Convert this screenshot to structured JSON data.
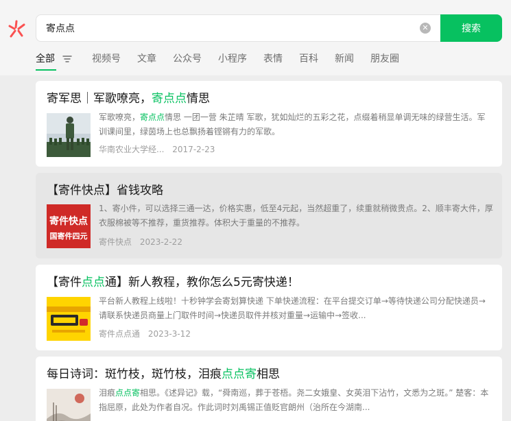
{
  "search": {
    "query": "寄点点",
    "button_label": "搜索",
    "clear_symbol": "✕"
  },
  "tabs": [
    {
      "label": "全部"
    },
    {
      "label": "视频号"
    },
    {
      "label": "文章"
    },
    {
      "label": "公众号"
    },
    {
      "label": "小程序"
    },
    {
      "label": "表情"
    },
    {
      "label": "百科"
    },
    {
      "label": "新闻"
    },
    {
      "label": "朋友圈"
    }
  ],
  "results": [
    {
      "title": [
        {
          "t": "寄军思｜军歌嘹亮，"
        },
        {
          "t": "寄点点",
          "hl": true
        },
        {
          "t": "情思"
        }
      ],
      "snippet": [
        {
          "t": "军歌嘹亮，"
        },
        {
          "t": "寄点点",
          "hl": true
        },
        {
          "t": "情思 一团一营 朱芷晴 军歌，犹如灿烂的五彩之花，点缀着稍显单调无味的绿营生活。军训课间里，绿茵场上也总飘扬着铿锵有力的军歌。"
        }
      ],
      "source": "华南农业大学经...",
      "date": "2017-2-23",
      "thumb_icon": "soldiers-photo-icon"
    },
    {
      "title": [
        {
          "t": "【寄件快点】省钱攻略"
        }
      ],
      "snippet": [
        {
          "t": "1、寄小件，可以选择三通一达，价格实惠，低至4元起，当然超重了，续重就稍微贵点。2、顺丰寄大件，厚衣服棉被等不推荐，重货推荐。体积大于重量的不推荐。"
        }
      ],
      "source": "寄件快点",
      "date": "2023-2-22",
      "thumb_icon": "promo-banner-icon",
      "thumb_text": [
        "寄件快点",
        "国寄件四元"
      ]
    },
    {
      "title": [
        {
          "t": "【寄件"
        },
        {
          "t": "点点",
          "hl": true
        },
        {
          "t": "通】新人教程，教你怎么5元寄快递！"
        }
      ],
      "snippet": [
        {
          "t": "平台新人教程上线啦！十秒钟学会寄划算快递 下单快递流程：在平台提交订单→等待快递公司分配快递员→请联系快递员商量上门取件时间→快递员取件并核对重量→运输中→签收..."
        }
      ],
      "source": "寄件点点通",
      "date": "2023-3-12",
      "thumb_icon": "yellow-poster-icon"
    },
    {
      "title": [
        {
          "t": "每日诗词：斑竹枝，斑竹枝，泪痕"
        },
        {
          "t": "点点寄",
          "hl": true
        },
        {
          "t": "相思"
        }
      ],
      "snippet": [
        {
          "t": "泪痕"
        },
        {
          "t": "点点寄",
          "hl": true
        },
        {
          "t": "相思。《述异记》载，“舜南巡，葬于苍梧。尧二女娥皇、女英泪下沾竹，文悉为之斑。” 楚客：本指屈原，此处为作者自况。作此词时刘禹锡正值贬官朗州（治所在今湖南..."
        }
      ],
      "thumb_icon": "ink-painting-icon"
    }
  ],
  "colors": {
    "accent": "#07c160",
    "logo": "#fa5151"
  }
}
